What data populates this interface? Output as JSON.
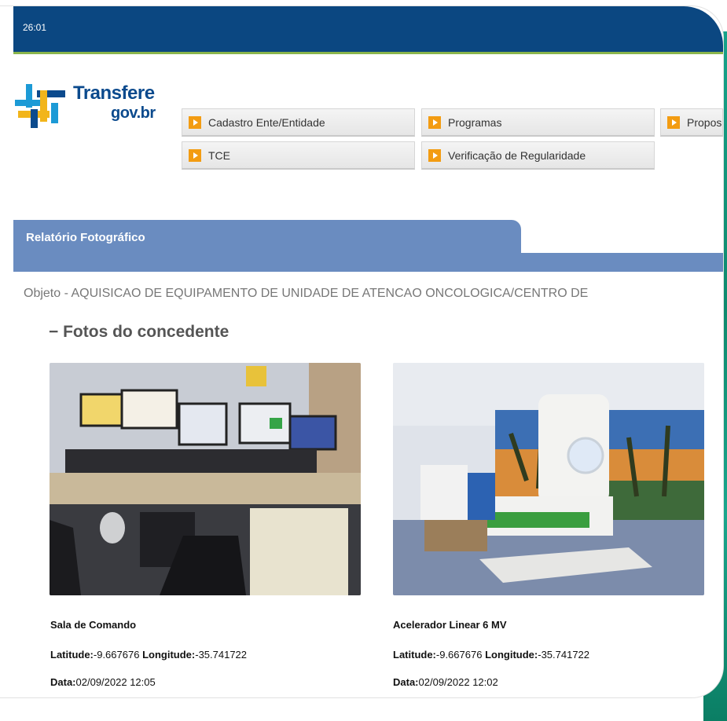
{
  "topbar": {
    "time": "26:01"
  },
  "logo": {
    "line1": "Transfere",
    "line2": "gov.br"
  },
  "menu": {
    "items": [
      {
        "label": "Cadastro Ente/Entidade"
      },
      {
        "label": "Programas"
      },
      {
        "label": "Propos"
      },
      {
        "label": "TCE"
      },
      {
        "label": "Verificação de Regularidade"
      }
    ]
  },
  "report": {
    "tab_label": "Relatório Fotográfico",
    "objeto": "Objeto - AQUISICAO DE EQUIPAMENTO DE UNIDADE DE ATENCAO ONCOLOGICA/CENTRO DE",
    "section_title": "Fotos do concedente",
    "collapse_symbol": "−"
  },
  "photos": [
    {
      "title": "Sala de Comando",
      "lat_label": "Latitude:",
      "lat": "-9.667676",
      "lon_label": "Longitude:",
      "lon": "-35.741722",
      "date_label": "Data:",
      "date": "02/09/2022 12:05"
    },
    {
      "title": "Acelerador Linear 6 MV",
      "lat_label": "Latitude:",
      "lat": "-9.667676",
      "lon_label": "Longitude:",
      "lon": "-35.741722",
      "date_label": "Data:",
      "date": "02/09/2022 12:02"
    }
  ],
  "colors": {
    "topbar": "#0b4781",
    "topbar_accent": "#8ab54c",
    "tab": "#6a8cc0",
    "menu_arrow": "#f39c12",
    "logo_text": "#0b4a8d"
  }
}
